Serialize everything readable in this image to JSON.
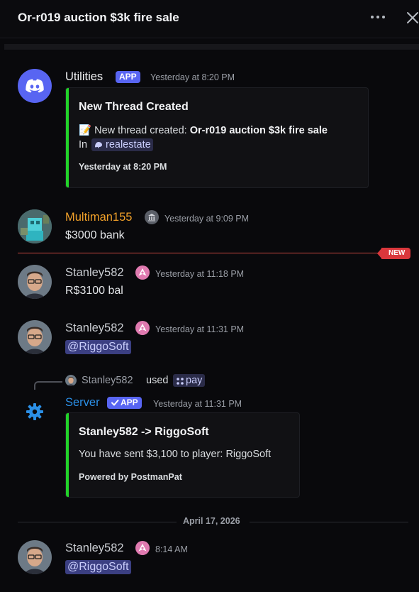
{
  "header": {
    "title": "Or-r019 auction $3k fire sale"
  },
  "colors": {
    "accent": "#5865f2",
    "embed_bar": "#22d32a",
    "new_marker": "#da373c",
    "orange_name": "#f0a029",
    "server_blue": "#2b8fe6"
  },
  "messages": {
    "utilities": {
      "author": "Utilities",
      "badge": "APP",
      "time": "Yesterday at 8:20 PM",
      "embed": {
        "title": "New Thread Created",
        "emoji": "📝",
        "line_prefix": "New thread created:",
        "line_bold": "Or-r019 auction $3k fire sale",
        "in_label": "In",
        "channel": "realestate",
        "footer": "Yesterday at 8:20 PM"
      }
    },
    "multiman": {
      "author": "Multiman155",
      "time": "Yesterday at 9:09 PM",
      "text": "$3000 bank"
    },
    "new_marker": "NEW",
    "stanley1": {
      "author": "Stanley582",
      "time": "Yesterday at 11:18 PM",
      "text": "R$3100 bal"
    },
    "stanley2": {
      "author": "Stanley582",
      "time": "Yesterday at 11:31 PM",
      "mention": "@RiggoSoft"
    },
    "server": {
      "reply_user": "Stanley582",
      "reply_used": "used",
      "reply_command": "pay",
      "author": "Server",
      "badge": "APP",
      "time": "Yesterday at 11:31 PM",
      "embed": {
        "title": "Stanley582 -> RiggoSoft",
        "text": "You have sent $3,100 to player: RiggoSoft",
        "footer": "Powered by PostmanPat"
      }
    },
    "date_divider": "April 17, 2026",
    "stanley3": {
      "author": "Stanley582",
      "time": "8:14 AM",
      "mention": "@RiggoSoft"
    }
  }
}
